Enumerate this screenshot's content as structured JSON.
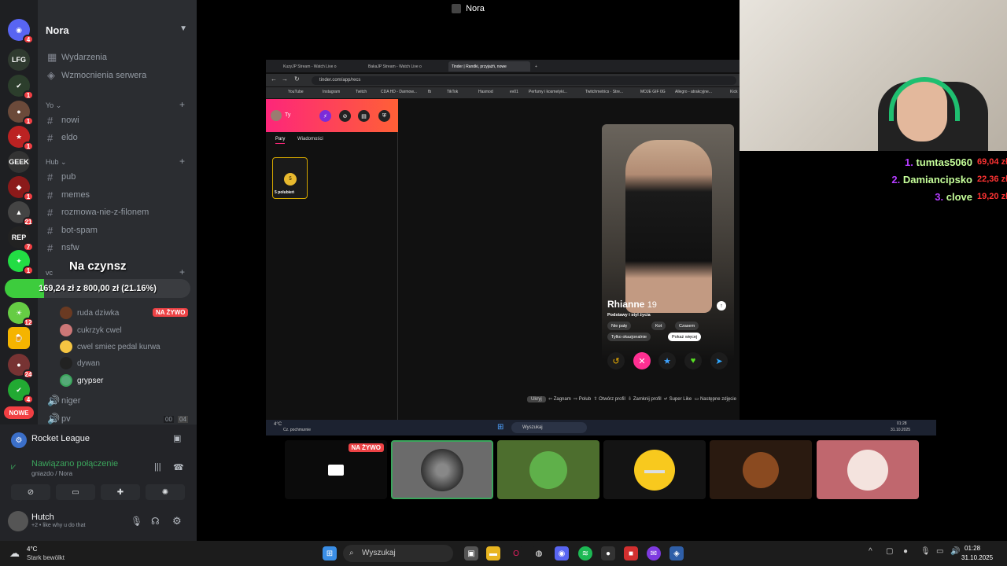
{
  "discord": {
    "server_name": "Nora",
    "new_label": "NOWE",
    "rail_badges": [
      "4",
      "1",
      "1",
      "1",
      "1",
      "21",
      "7",
      "1",
      "12",
      "24",
      "4"
    ],
    "top_items": [
      "Wydarzenia",
      "Wzmocnienia serwera"
    ],
    "categories": [
      "Yo",
      "Hub",
      "vc"
    ],
    "channels_yo": [
      "nowi",
      "eldo"
    ],
    "channels_hub": [
      "pub",
      "memes",
      "rozmowa-nie-z-filonem",
      "bot-spam",
      "nsfw"
    ],
    "voice_users": [
      {
        "name": "ruda dziwka",
        "live": "NA ŻYWO"
      },
      {
        "name": "cukrzyk cwel"
      },
      {
        "name": "cwel smiec pedal kurwa"
      },
      {
        "name": "dywan"
      },
      {
        "name": "grypser"
      }
    ],
    "channels_after": [
      "niger",
      "pv"
    ],
    "pv_counts": [
      "00",
      "04"
    ],
    "activity": "Rocket League",
    "voice_status": "Nawiązano połączenie",
    "voice_location": "gniazdo / Nora",
    "user": {
      "name": "Hutch",
      "status": "+2 • like why u do that"
    }
  },
  "goal": {
    "title": "Na czynsz",
    "text": "169,24 zł z 800,00 zł (21.16%)",
    "progress": 0.2116
  },
  "stream": {
    "title": "Nora"
  },
  "browser": {
    "tabs": [
      "KuzyJP Stream - Watch Live o",
      "BakaJP Stream - Watch Live o",
      "Tinder | Randki, przyjaźń, nowe"
    ],
    "url": "tinder.com/app/recs",
    "bookmarks": [
      "YouTube",
      "Instagram",
      "Twitch",
      "CDA HD - Darmow...",
      "fb",
      "TikTok",
      "Hasmod",
      "ev01",
      "Perfumy i kosmetyki...",
      "Twitchmetrics · Stre...",
      "MOJE GIF 0G",
      "Allegro - atrakcyjne...",
      "Kick"
    ]
  },
  "tinder": {
    "user": "Ty",
    "tab_matches": "Pary",
    "tab_messages": "Wiadomości",
    "likes_count": "5",
    "likes_label": "5 polubień",
    "profile_name": "Rhianne",
    "profile_age": "19",
    "profile_section": "Podstawy i styl życia",
    "tags": [
      "Nie palę",
      "Kot",
      "Czasem",
      "Tylko okazjonalnie",
      "Pokaż więcej"
    ],
    "shortcuts": [
      "Ukryj",
      "Zagnam",
      "Polub",
      "Otwórz profil",
      "Zamknij profil",
      "Super Like",
      "Następne zdjęcie"
    ]
  },
  "inner_taskbar": {
    "weather": "4°C",
    "weather_desc": "Cz. pochmurnie",
    "search": "Wyszukaj",
    "time": "01:28",
    "date": "31.10.2025"
  },
  "donors": [
    {
      "rank": "1.",
      "name": "tumtas5060",
      "amount": "69,04 zł"
    },
    {
      "rank": "2.",
      "name": "Damiancipsko",
      "amount": "22,36 zł"
    },
    {
      "rank": "3.",
      "name": "clove",
      "amount": "19,20 zł"
    }
  ],
  "tiles": {
    "live_label": "NA ŻYWO"
  },
  "taskbar": {
    "weather_temp": "4°C",
    "weather_desc": "Stark bewölkt",
    "search": "Wyszukaj",
    "time": "01:28",
    "date": "31.10.2025"
  },
  "colors": {
    "discord_bg": "#2b2d31",
    "rail_bg": "#1e1f22",
    "tinder_gradient_start": "#fd267a",
    "tinder_gradient_end": "#ff6036",
    "goal_fill": "#3dcc3d",
    "live_red": "#ed4245"
  }
}
